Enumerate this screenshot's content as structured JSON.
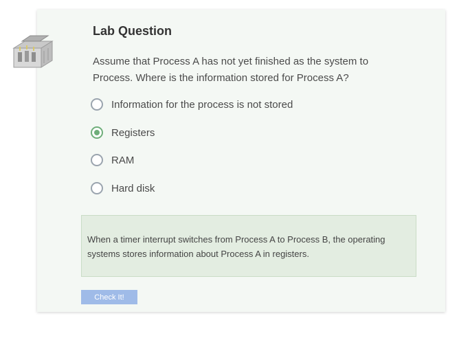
{
  "lab": {
    "title": "Lab Question",
    "question": "Assume that Process A has not yet finished as the system to Process. Where is the information stored for Process A?",
    "options": [
      {
        "label": "Information for the process is not stored",
        "selected": false
      },
      {
        "label": "Registers",
        "selected": true
      },
      {
        "label": "RAM",
        "selected": false
      },
      {
        "label": "Hard disk",
        "selected": false
      }
    ],
    "feedback": "When a timer interrupt switches from Process A to Process B, the operating systems stores information about Process A in registers.",
    "check_button_label": "Check It!"
  },
  "icons": {
    "lab_icon": "lab-building-icon"
  },
  "colors": {
    "selected_radio": "#6fae7a",
    "feedback_background": "#e3ede1",
    "button_background": "#9fbbe8",
    "card_background": "#f4f8f4"
  }
}
